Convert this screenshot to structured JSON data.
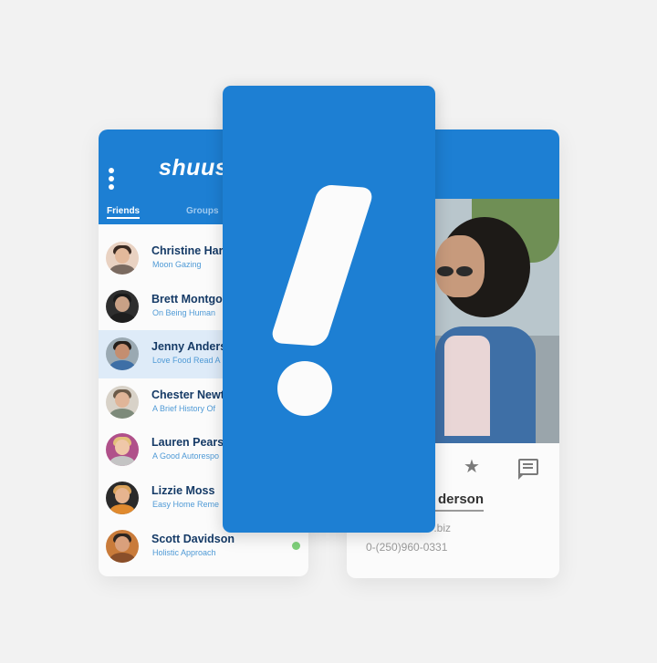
{
  "friends_app": {
    "logo": "shuus",
    "tabs": [
      "Friends",
      "Groups"
    ],
    "active_tab": "Friends",
    "contacts": [
      {
        "name": "Christine Har",
        "subtitle": "Moon Gazing"
      },
      {
        "name": "Brett Montgo",
        "subtitle": "On Being Human"
      },
      {
        "name": "Jenny Anders",
        "subtitle": "Love Food Read A"
      },
      {
        "name": "Chester Newt",
        "subtitle": "A Brief History Of"
      },
      {
        "name": "Lauren Pears",
        "subtitle": "A Good Autorespo"
      },
      {
        "name": "Lizzie Moss",
        "subtitle": "Easy Home Reme"
      },
      {
        "name": "Scott Davidson",
        "subtitle": "Holistic Approach"
      }
    ],
    "highlighted_index": 2,
    "online_indicator_color": "#7ed07a"
  },
  "profile": {
    "name": "derson",
    "email": ".biz",
    "phone": "0-(250)960-0331"
  },
  "colors": {
    "brand_blue": "#1d7fd3",
    "name_text": "#153a66",
    "subtitle_text": "#4f9ad6",
    "highlight_row": "#deebf8"
  },
  "icons": [
    "kebab-menu-icon",
    "star-icon",
    "message-icon",
    "exclamation-icon"
  ]
}
